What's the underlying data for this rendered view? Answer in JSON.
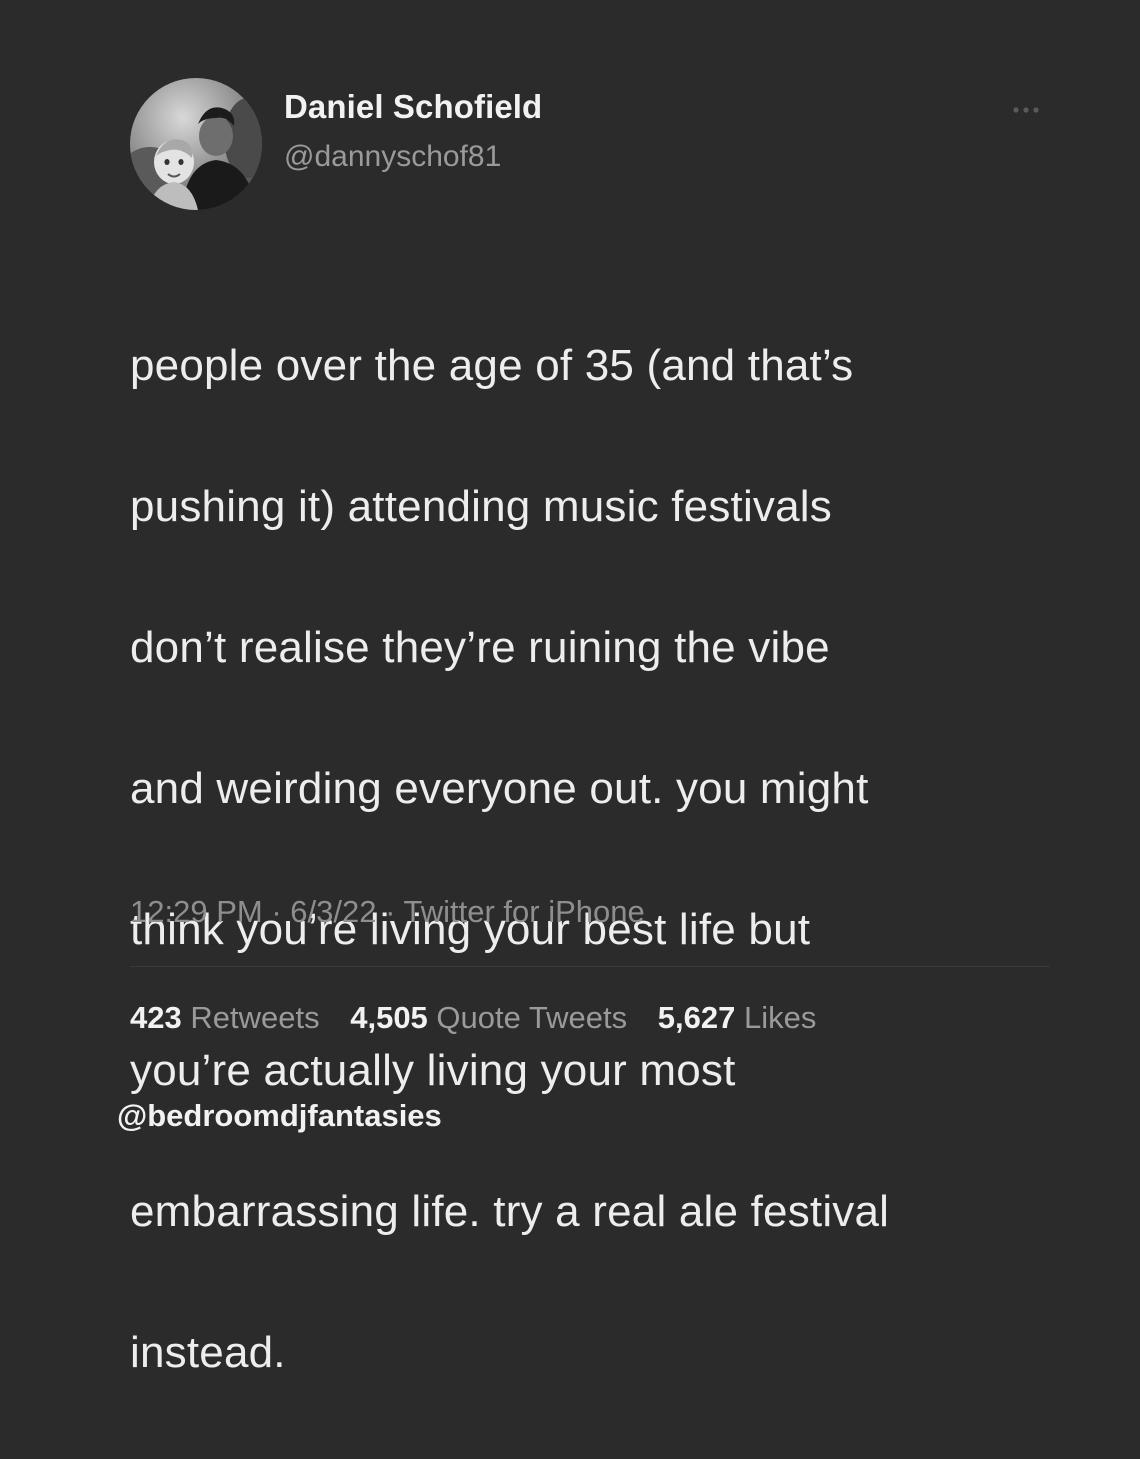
{
  "author": {
    "display_name": "Daniel Schofield",
    "handle": "@dannyschof81",
    "avatar_icon": "profile-photo"
  },
  "tweet": {
    "lines": [
      "people over the age of 35 (and that’s",
      "pushing it) attending music festivals",
      "don’t realise they’re ruining the vibe",
      "and weirding everyone out. you might",
      "think you’re living your best life but",
      "you’re actually living your most",
      "embarrassing life. try a real ale festival",
      "instead."
    ]
  },
  "meta": {
    "time": "12:29 PM",
    "date": "6/3/22",
    "source": "Twitter for iPhone",
    "separator": "·"
  },
  "stats": {
    "retweets_count": "423",
    "retweets_label": "Retweets",
    "quote_tweets_count": "4,505",
    "quote_tweets_label": "Quote Tweets",
    "likes_count": "5,627",
    "likes_label": "Likes"
  },
  "watermark": "@bedroomdjfantasies",
  "colors": {
    "background": "#2b2b2b",
    "primary_text": "#ededed",
    "secondary_text": "#9a9a9a"
  }
}
